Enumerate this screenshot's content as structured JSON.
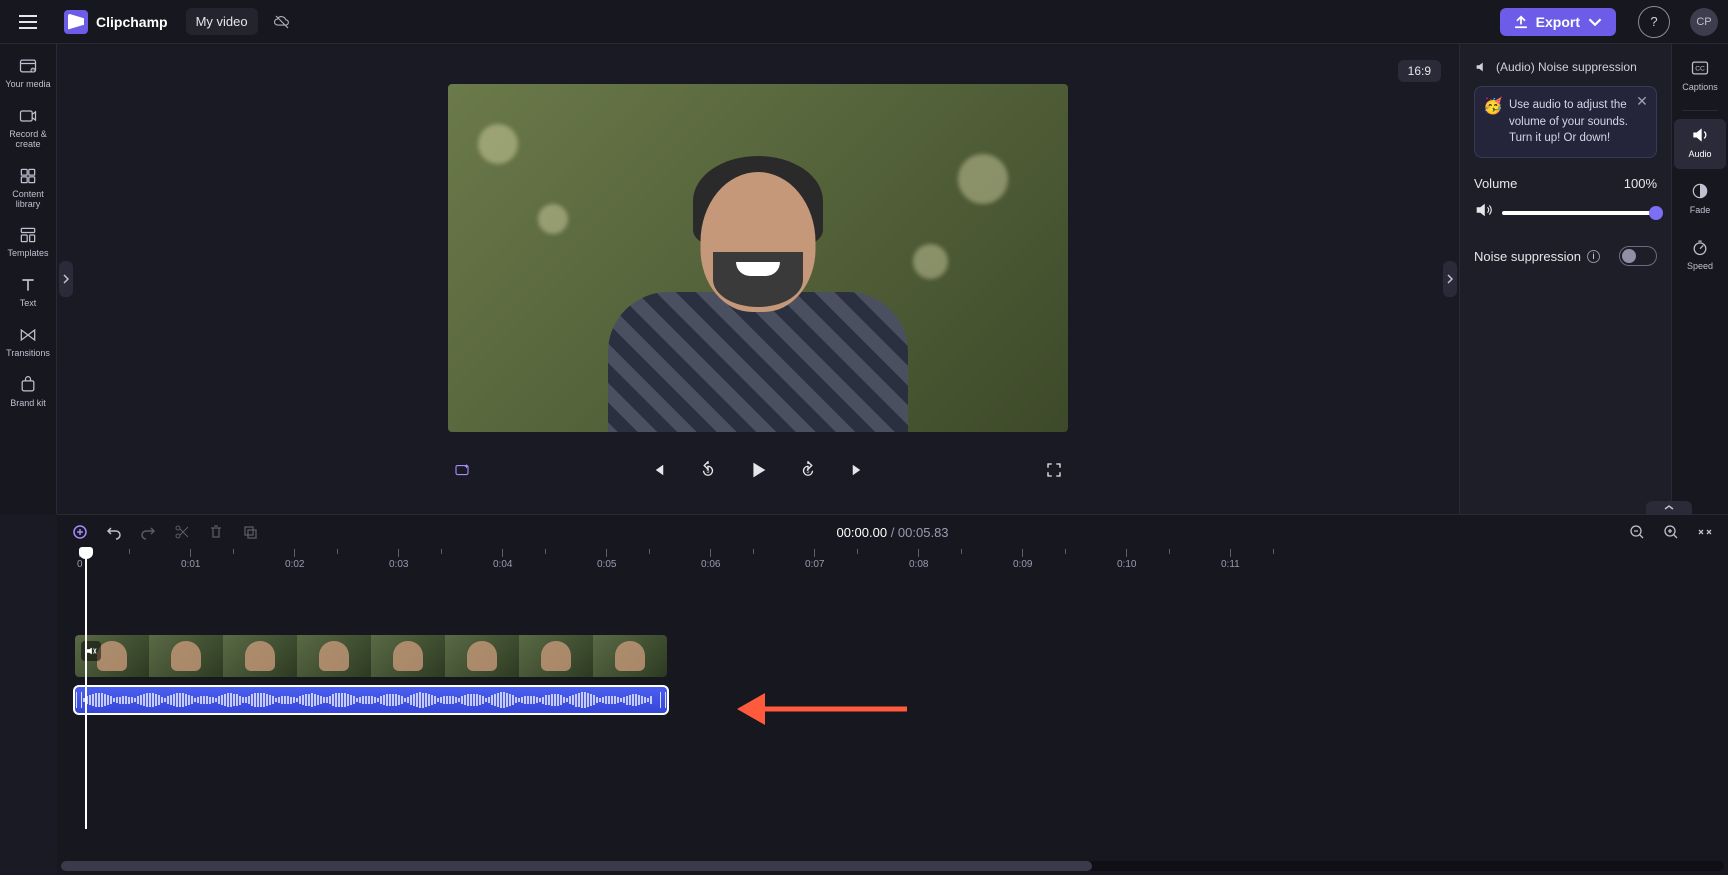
{
  "app": {
    "name": "Clipchamp",
    "project": "My video"
  },
  "topbar": {
    "export": "Export",
    "avatar": "CP"
  },
  "leftbar": [
    {
      "id": "your-media",
      "label": "Your media"
    },
    {
      "id": "record-create",
      "label": "Record & create"
    },
    {
      "id": "content-library",
      "label": "Content library"
    },
    {
      "id": "templates",
      "label": "Templates"
    },
    {
      "id": "text",
      "label": "Text"
    },
    {
      "id": "transitions",
      "label": "Transitions"
    },
    {
      "id": "brand-kit",
      "label": "Brand kit"
    }
  ],
  "canvas": {
    "aspect": "16:9"
  },
  "rightpanel": {
    "header": "(Audio) Noise suppression",
    "tip": "Use audio to adjust the volume of your sounds. Turn it up! Or down!",
    "volume_label": "Volume",
    "volume_value": "100%",
    "noise_label": "Noise suppression",
    "noise_on": false
  },
  "farbar": [
    {
      "id": "captions",
      "label": "Captions"
    },
    {
      "id": "audio",
      "label": "Audio",
      "active": true
    },
    {
      "id": "fade",
      "label": "Fade"
    },
    {
      "id": "speed",
      "label": "Speed"
    }
  ],
  "timeline": {
    "current": "00:00.00",
    "sep": " / ",
    "duration": "00:05.83",
    "ruler_start": "0",
    "marks": [
      "0:01",
      "0:02",
      "0:03",
      "0:04",
      "0:05",
      "0:06",
      "0:07",
      "0:08",
      "0:09",
      "0:10",
      "0:11"
    ]
  }
}
